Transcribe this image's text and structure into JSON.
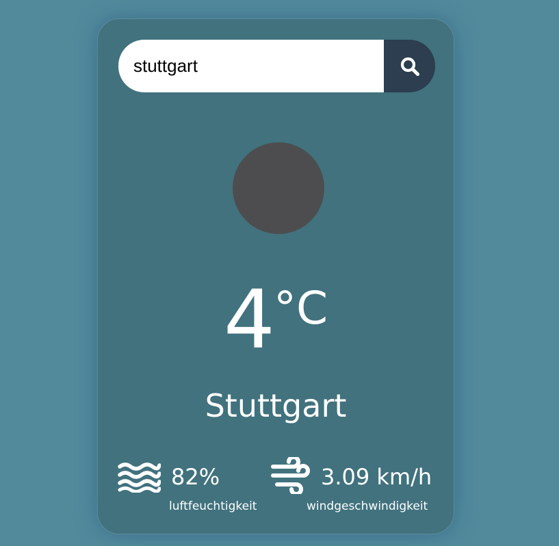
{
  "search": {
    "value": "stuttgart",
    "button_icon": "search-icon"
  },
  "weather": {
    "icon": "weather-condition-icon",
    "temperature": "4",
    "unit": "°C",
    "city": "Stuttgart"
  },
  "details": {
    "humidity": {
      "icon": "water-waves-icon",
      "value": "82%",
      "label": "luftfeuchtigkeit"
    },
    "wind": {
      "icon": "wind-icon",
      "value": "3.09 km/h",
      "label": "windgeschwindigkeit"
    }
  },
  "colors": {
    "background": "#528a9c",
    "card": "#41727e",
    "search_button": "#2c3e50",
    "icon_placeholder": "#4d4d4f"
  }
}
